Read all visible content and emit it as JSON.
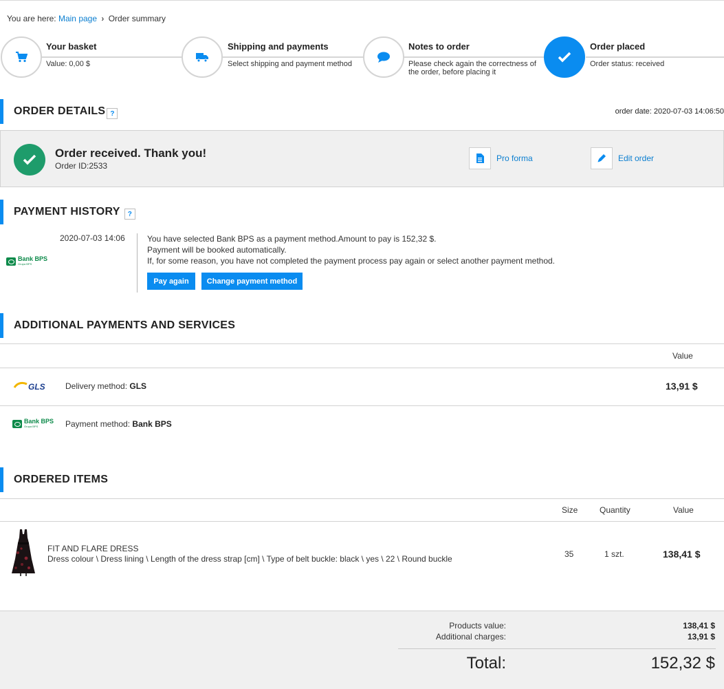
{
  "breadcrumb": {
    "prefix": "You are here:",
    "items": [
      "Main page",
      "Order summary"
    ]
  },
  "steps": [
    {
      "title": "Your basket",
      "sub": "Value: 0,00 $"
    },
    {
      "title": "Shipping and payments",
      "sub": "Select shipping and payment method"
    },
    {
      "title": "Notes to order",
      "sub": "Please check again the correctness of the order, before placing it"
    },
    {
      "title": "Order placed",
      "sub": "Order status: received"
    }
  ],
  "order_details": {
    "heading": "ORDER DETAILS",
    "help": "?",
    "date": "order date: 2020-07-03 14:06:50",
    "status_title": "Order received. Thank you!",
    "order_id": "Order ID:2533",
    "pro_forma": "Pro forma",
    "edit_order": "Edit order"
  },
  "payment_history": {
    "heading": "PAYMENT HISTORY",
    "help": "?",
    "date": "2020-07-03 14:06",
    "line1": "You have selected Bank BPS as a payment method.Amount to pay is 152,32 $.",
    "line2": "Payment will be booked automatically.",
    "line3": "If, for some reason, you have not completed the payment process pay again or select another payment method.",
    "pay_again": "Pay again",
    "change_method": "Change payment method",
    "logo_text": "Bank BPS",
    "logo_sub": "Grupa BPS"
  },
  "additional": {
    "heading": "ADDITIONAL PAYMENTS AND SERVICES",
    "value_header": "Value",
    "rows": [
      {
        "logo": "GLS",
        "label": "Delivery method:",
        "value_name": "GLS",
        "amount": "13,91 $"
      },
      {
        "logo": "Bank BPS",
        "label": "Payment method:",
        "value_name": "Bank BPS",
        "amount": ""
      }
    ]
  },
  "ordered_items": {
    "heading": "ORDERED ITEMS",
    "headers": {
      "size": "Size",
      "quantity": "Quantity",
      "value": "Value"
    },
    "items": [
      {
        "name": "FIT AND FLARE DRESS",
        "details": "Dress colour \\ Dress lining \\ Length of the dress strap [cm] \\ Type of belt buckle: black \\ yes \\ 22 \\ Round buckle",
        "size": "35",
        "quantity": "1 szt.",
        "value": "138,41 $"
      }
    ]
  },
  "summary": {
    "products_label": "Products value:",
    "products_value": "138,41 $",
    "charges_label": "Additional charges:",
    "charges_value": "13,91 $",
    "total_label": "Total:",
    "total_value": "152,32 $"
  },
  "colors": {
    "accent": "#0a8cf0",
    "success": "#1e9c6b",
    "link": "#0a7ed0",
    "gls_yellow": "#f2b600",
    "gls_blue": "#1d3f8f",
    "bps_green": "#0d8a4a"
  },
  "icons": [
    "cart-icon",
    "truck-icon",
    "chat-bubble-icon",
    "check-icon",
    "document-icon",
    "pencil-icon"
  ]
}
